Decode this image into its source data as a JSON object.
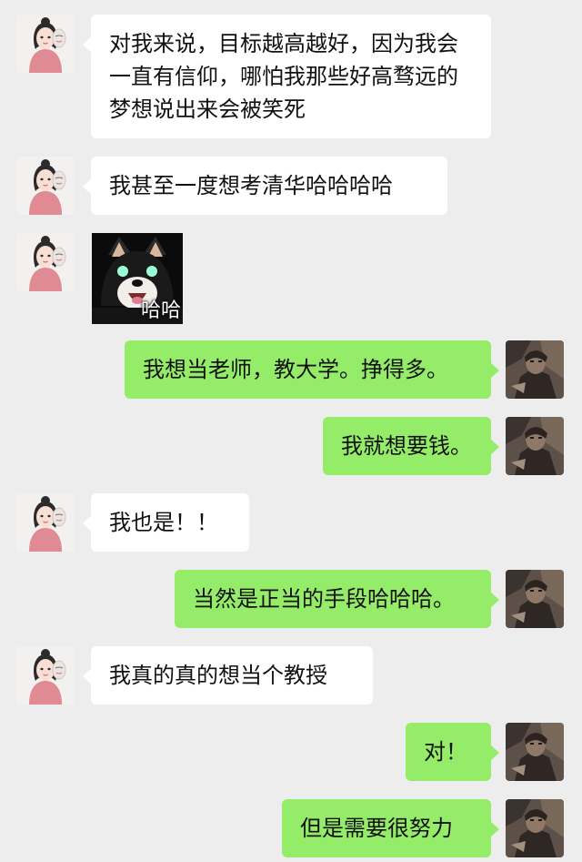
{
  "chat": {
    "messages": [
      {
        "side": "left",
        "text": "对我来说，目标越高越好，因为我会一直有信仰，哪怕我那些好高骛远的梦想说出来会被笑死"
      },
      {
        "side": "left",
        "text": "我甚至一度想考清华哈哈哈哈"
      },
      {
        "side": "left",
        "type": "sticker",
        "caption": "哈哈"
      },
      {
        "side": "right",
        "text": "我想当老师，教大学。挣得多。"
      },
      {
        "side": "right",
        "text": "我就想要钱。"
      },
      {
        "side": "left",
        "text": "我也是！！"
      },
      {
        "side": "right",
        "text": "当然是正当的手段哈哈哈。"
      },
      {
        "side": "left",
        "text": "我真的真的想当个教授"
      },
      {
        "side": "right",
        "text": "对！"
      },
      {
        "side": "right",
        "text": "但是需要很努力"
      }
    ]
  },
  "colors": {
    "background": "#ededed",
    "left_bubble": "#ffffff",
    "right_bubble": "#95ec69",
    "text": "#111111"
  },
  "icons": {
    "left_avatar": "illustrated-girl-avatar",
    "right_avatar": "dark-photo-avatar",
    "sticker": "laughing-shiba-dog"
  }
}
